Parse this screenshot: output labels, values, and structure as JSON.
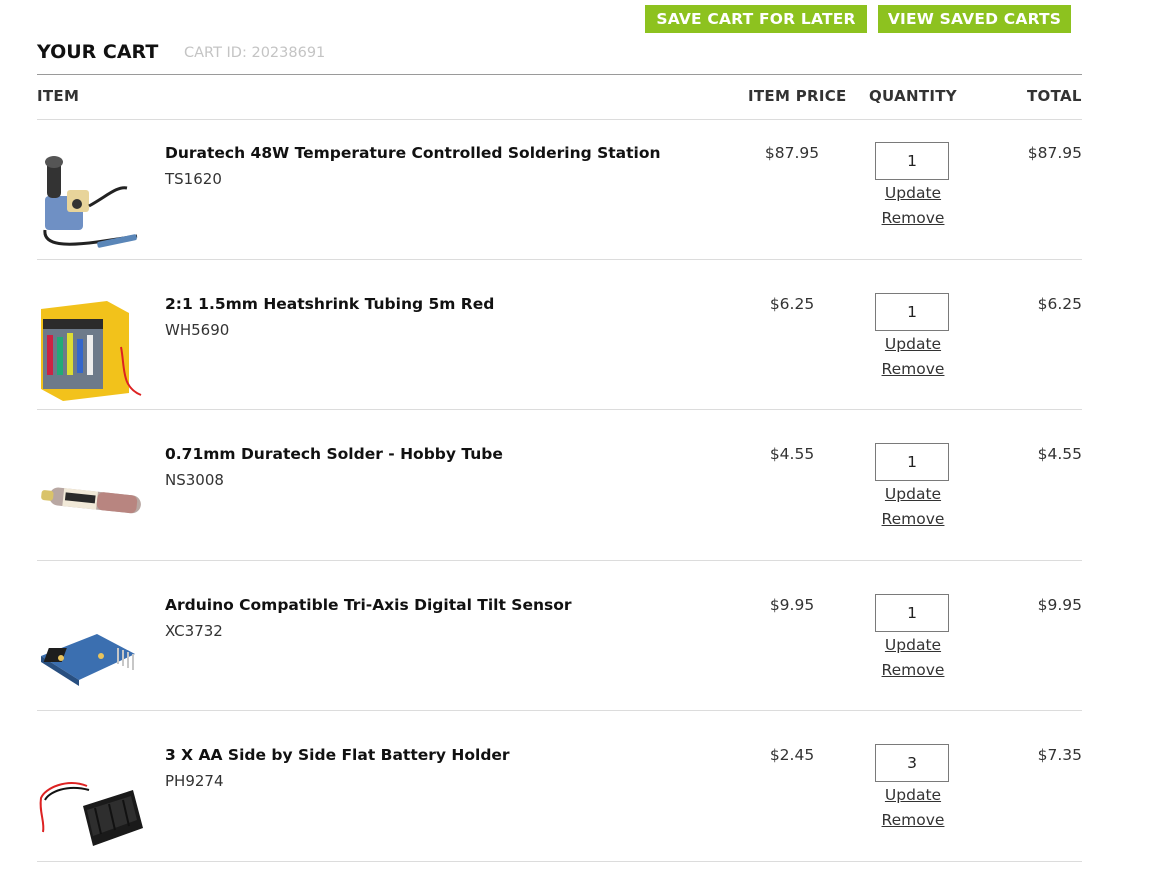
{
  "actions": {
    "save_cart": "SAVE CART FOR LATER",
    "view_saved": "VIEW SAVED CARTS"
  },
  "cart": {
    "title": "YOUR CART",
    "id_label": "CART ID: 20238691"
  },
  "table": {
    "headers": {
      "item": "ITEM",
      "price": "ITEM PRICE",
      "quantity": "QUANTITY",
      "total": "TOTAL"
    },
    "update_label": "Update",
    "remove_label": "Remove",
    "rows": [
      {
        "name": "Duratech 48W Temperature Controlled Soldering Station",
        "sku": "TS1620",
        "price": "$87.95",
        "qty": "1",
        "total": "$87.95",
        "image": "soldering-station-icon"
      },
      {
        "name": "2:1 1.5mm Heatshrink Tubing 5m Red",
        "sku": "WH5690",
        "price": "$6.25",
        "qty": "1",
        "total": "$6.25",
        "image": "heatshrink-box-icon"
      },
      {
        "name": "0.71mm Duratech Solder - Hobby Tube",
        "sku": "NS3008",
        "price": "$4.55",
        "qty": "1",
        "total": "$4.55",
        "image": "solder-tube-icon"
      },
      {
        "name": "Arduino Compatible Tri-Axis Digital Tilt Sensor",
        "sku": "XC3732",
        "price": "$9.95",
        "qty": "1",
        "total": "$9.95",
        "image": "tilt-sensor-icon"
      },
      {
        "name": "3 X AA Side by Side Flat Battery Holder",
        "sku": "PH9274",
        "price": "$2.45",
        "qty": "3",
        "total": "$7.35",
        "image": "battery-holder-icon"
      }
    ]
  },
  "colors": {
    "accent_green": "#8dc21f",
    "muted_text": "#c4c4c4"
  }
}
